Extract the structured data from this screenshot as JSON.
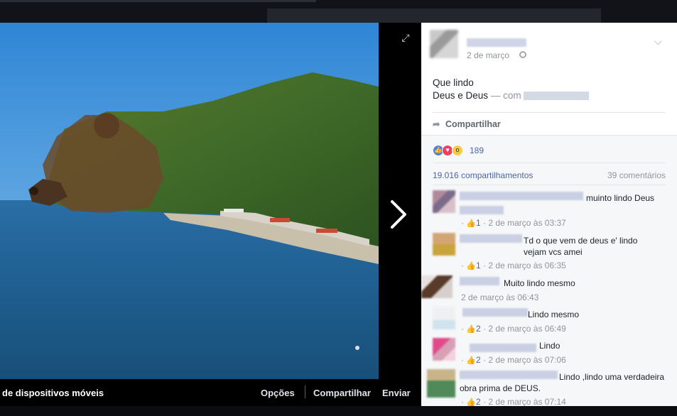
{
  "viewer": {
    "caption": "de dispositivos móveis",
    "options_label": "Opções",
    "share_label": "Compartilhar",
    "send_label": "Enviar"
  },
  "post": {
    "date": "2 de março",
    "text_line1": "Que lindo",
    "text_line2": "Deus e Deus",
    "with_prefix": "— com",
    "share_action": "Compartilhar",
    "reaction_count": "189",
    "shares": "19.016 compartilhamentos",
    "comments": "39 comentários"
  },
  "comments": [
    {
      "text": "muinto lindo Deus",
      "likes": "1",
      "time": "2 de março às 03:37"
    },
    {
      "text": "Td o que vem de deus e' lindo vejam vcs amei",
      "likes": "1",
      "time": "2 de março às 06:35"
    },
    {
      "text": "Muito lindo mesmo",
      "likes": "",
      "time": "2 de março às 06:43"
    },
    {
      "text": "Lindo mesmo",
      "likes": "2",
      "time": "2 de março às 06:49"
    },
    {
      "text": "Lindo",
      "likes": "2",
      "time": "2 de março às 07:06"
    },
    {
      "text": "Lindo ,lindo uma verdadeira obra prima de DEUS.",
      "likes": "2",
      "time": "2 de março às 07:14"
    }
  ],
  "colors": {
    "link": "#4b67a1",
    "meta": "#90949c"
  }
}
